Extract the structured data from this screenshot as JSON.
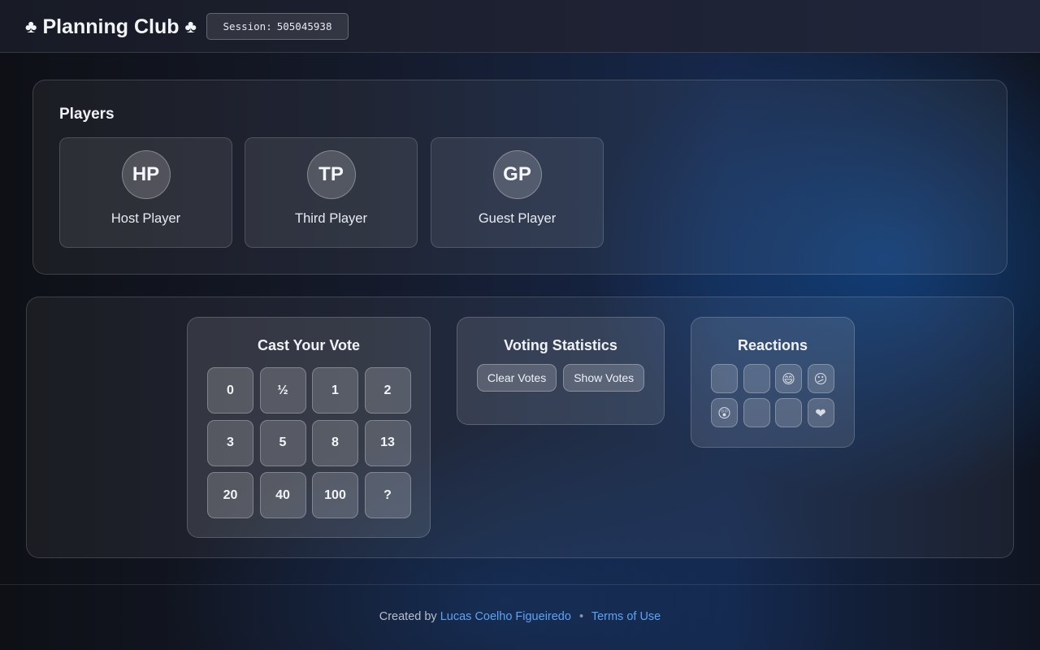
{
  "header": {
    "title": "Planning Club",
    "title_icon": "♣",
    "session_label": "Session:",
    "session_id": "505045938"
  },
  "players": {
    "title": "Players",
    "list": [
      {
        "initials": "HP",
        "name": "Host Player"
      },
      {
        "initials": "TP",
        "name": "Third Player"
      },
      {
        "initials": "GP",
        "name": "Guest Player"
      }
    ]
  },
  "vote": {
    "title": "Cast Your Vote",
    "cards": [
      "0",
      "½",
      "1",
      "2",
      "3",
      "5",
      "8",
      "13",
      "20",
      "40",
      "100",
      "?"
    ]
  },
  "stats": {
    "title": "Voting Statistics",
    "clear_label": "Clear Votes",
    "show_label": "Show Votes"
  },
  "reactions": {
    "title": "Reactions",
    "items": [
      {
        "icon": "thumbs-up-icon",
        "glyph": ""
      },
      {
        "icon": "thumbs-down-icon",
        "glyph": ""
      },
      {
        "icon": "grinning-face-icon",
        "glyph": "😄"
      },
      {
        "icon": "confused-face-icon",
        "glyph": "😕"
      },
      {
        "icon": "astonished-face-icon",
        "glyph": "😲"
      },
      {
        "icon": "party-popper-icon",
        "glyph": ""
      },
      {
        "icon": "thinking-face-icon",
        "glyph": ""
      },
      {
        "icon": "heart-icon",
        "glyph": "❤"
      }
    ]
  },
  "footer": {
    "created_by": "Created by",
    "author": "Lucas Coelho Figueiredo",
    "separator": "•",
    "terms": "Terms of Use",
    "link_color": "#5ea2f5"
  }
}
